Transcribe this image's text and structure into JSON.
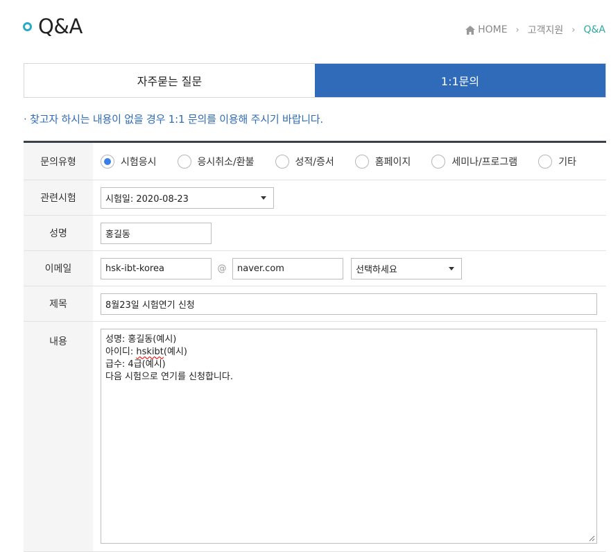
{
  "page": {
    "title": "Q&A"
  },
  "breadcrumb": {
    "items": [
      "HOME",
      "고객지원",
      "Q&A"
    ]
  },
  "tabs": [
    {
      "label": "자주묻는 질문",
      "active": false
    },
    {
      "label": "1:1문의",
      "active": true
    }
  ],
  "notice": "· 찾고자 하시는 내용이 없을 경우 1:1 문의를 이용해 주시기 바랍니다.",
  "form": {
    "inquiry_type": {
      "label": "문의유형",
      "options": [
        "시험응시",
        "응시취소/환불",
        "성적/증서",
        "홈페이지",
        "세미나/프로그램",
        "기타"
      ],
      "selected": "시험응시"
    },
    "related_exam": {
      "label": "관련시험",
      "selected": "시험일: 2020-08-23"
    },
    "name": {
      "label": "성명",
      "value": "홍길동"
    },
    "email": {
      "label": "이메일",
      "id_value": "hsk-ibt-korea",
      "at_symbol": "@",
      "domain_value": "naver.com",
      "domain_select": "선택하세요"
    },
    "subject": {
      "label": "제목",
      "value": "8월23일 시험연기 신청"
    },
    "content": {
      "label": "내용",
      "lines": {
        "line1": "성명: 홍길동(예시)",
        "line2_prefix": "아이디: ",
        "line2_spell": "hskibt",
        "line2_suffix": "(예시)",
        "line3": "급수: 4급(예시)",
        "line4": "다음 시험으로 연기를 신청합니다."
      }
    }
  },
  "colors": {
    "accent_blue": "#2f6bb8",
    "title_dot": "#2aa9c8",
    "breadcrumb_active": "#2aa9a0",
    "radio_checked": "#3a7ee6"
  }
}
